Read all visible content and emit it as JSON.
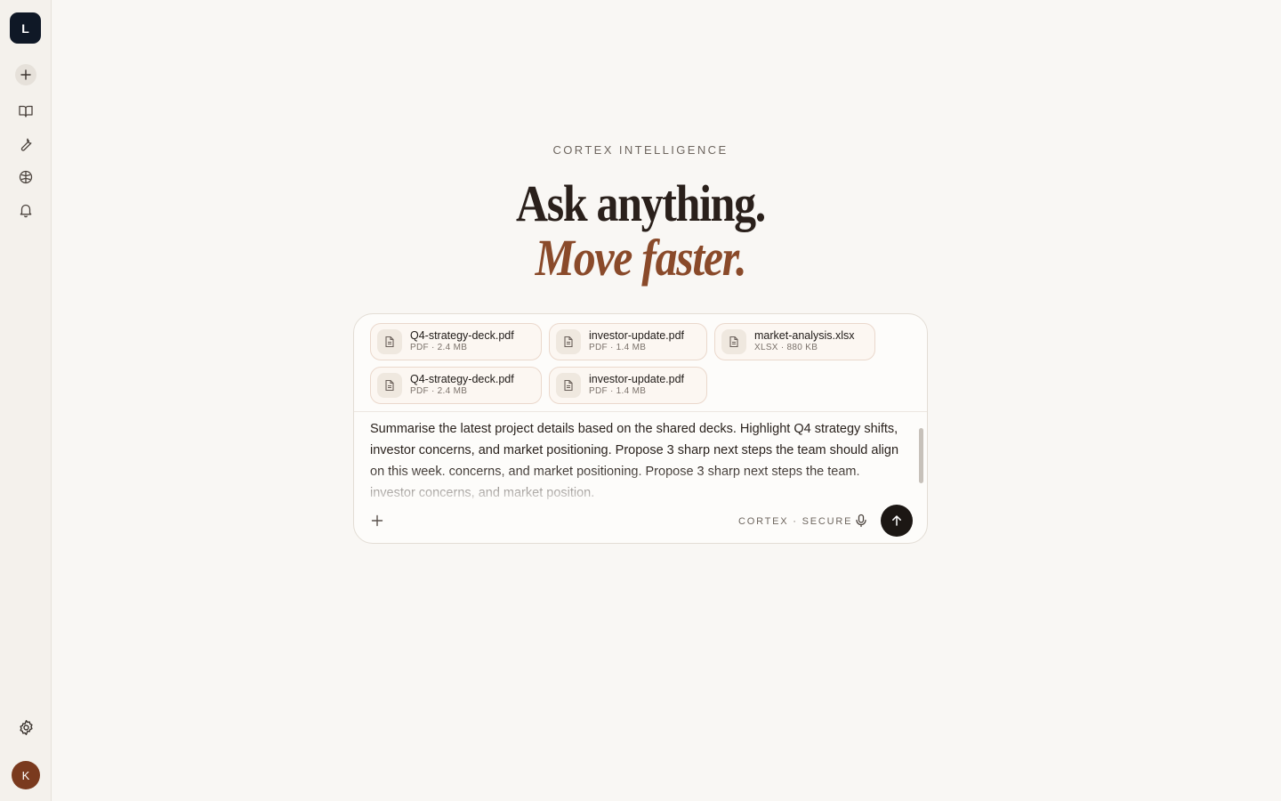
{
  "sidebar": {
    "logo_letter": "L",
    "avatar_letter": "K",
    "icons": [
      "plus-icon",
      "book-icon",
      "wrench-icon",
      "brain-icon",
      "bell-icon",
      "settings-icon"
    ]
  },
  "hero": {
    "eyebrow": "CORTEX INTELLIGENCE",
    "line1": "Ask anything.",
    "line2": "Move faster."
  },
  "composer": {
    "attachments": [
      {
        "name": "Q4-strategy-deck.pdf",
        "meta": "PDF · 2.4 MB"
      },
      {
        "name": "investor-update.pdf",
        "meta": "PDF · 1.4 MB"
      },
      {
        "name": "market-analysis.xlsx",
        "meta": "XLSX · 880 KB"
      },
      {
        "name": "Q4-strategy-deck.pdf",
        "meta": "PDF · 2.4 MB"
      },
      {
        "name": "investor-update.pdf",
        "meta": "PDF · 1.4 MB"
      }
    ],
    "prompt_text": "Summarise the latest project details based on the shared decks. Highlight Q4 strategy shifts, investor concerns, and market positioning. Propose 3 sharp next steps the team should align on this week. concerns, and market positioning. Propose 3 sharp next steps the team. investor concerns, and market position.",
    "secure_label": "CORTEX · SECURE"
  },
  "colors": {
    "background": "#f9f7f4",
    "sidebar": "#f4f1ec",
    "logo_bg": "#0f1826",
    "accent": "#8a4a2a",
    "avatar_bg": "#7a3a1e",
    "send_bg": "#1c1714"
  }
}
